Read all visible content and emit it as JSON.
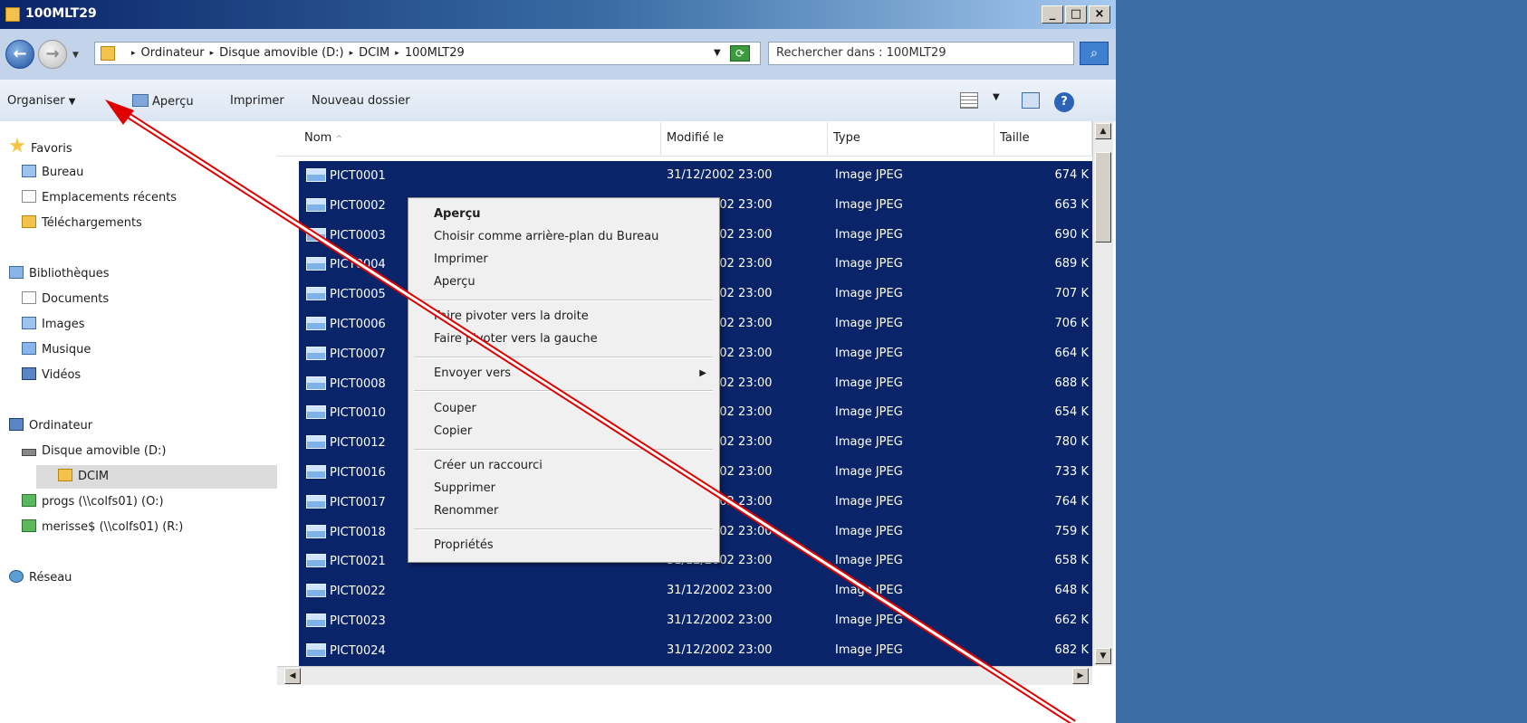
{
  "window": {
    "title": "100MLT29"
  },
  "address": {
    "crumbs": [
      "Ordinateur",
      "Disque amovible (D:)",
      "DCIM",
      "100MLT29"
    ],
    "search_placeholder": "Rechercher dans : 100MLT29"
  },
  "toolbar": {
    "organize_label": "Organiser",
    "preview_label": "Aperçu",
    "print_label": "Imprimer",
    "new_folder_label": "Nouveau dossier"
  },
  "nav": {
    "favorites": "Favoris",
    "desktop": "Bureau",
    "recent": "Emplacements récents",
    "downloads": "Téléchargements",
    "libraries": "Bibliothèques",
    "documents": "Documents",
    "images": "Images",
    "music": "Musique",
    "videos": "Vidéos",
    "computer": "Ordinateur",
    "removable": "Disque amovible (D:)",
    "dcim": "DCIM",
    "progs": "progs (\\\\colfs01) (O:)",
    "merisse": "merisse$ (\\\\colfs01) (R:)",
    "network": "Réseau"
  },
  "columns": {
    "name": "Nom",
    "modified": "Modifié le",
    "type": "Type",
    "size": "Taille"
  },
  "files": [
    {
      "name": "PICT0001",
      "modified": "31/12/2002 23:00",
      "type": "Image JPEG",
      "size": "674 K"
    },
    {
      "name": "PICT0002",
      "modified": "31/12/2002 23:00",
      "type": "Image JPEG",
      "size": "663 K"
    },
    {
      "name": "PICT0003",
      "modified": "31/12/2002 23:00",
      "type": "Image JPEG",
      "size": "690 K"
    },
    {
      "name": "PICT0004",
      "modified": "31/12/2002 23:00",
      "type": "Image JPEG",
      "size": "689 K"
    },
    {
      "name": "PICT0005",
      "modified": "31/12/2002 23:00",
      "type": "Image JPEG",
      "size": "707 K"
    },
    {
      "name": "PICT0006",
      "modified": "31/12/2002 23:00",
      "type": "Image JPEG",
      "size": "706 K"
    },
    {
      "name": "PICT0007",
      "modified": "31/12/2002 23:00",
      "type": "Image JPEG",
      "size": "664 K"
    },
    {
      "name": "PICT0008",
      "modified": "31/12/2002 23:00",
      "type": "Image JPEG",
      "size": "688 K"
    },
    {
      "name": "PICT0010",
      "modified": "31/12/2002 23:00",
      "type": "Image JPEG",
      "size": "654 K"
    },
    {
      "name": "PICT0012",
      "modified": "31/12/2002 23:00",
      "type": "Image JPEG",
      "size": "780 K"
    },
    {
      "name": "PICT0016",
      "modified": "31/12/2002 23:00",
      "type": "Image JPEG",
      "size": "733 K"
    },
    {
      "name": "PICT0017",
      "modified": "31/12/2002 23:00",
      "type": "Image JPEG",
      "size": "764 K"
    },
    {
      "name": "PICT0018",
      "modified": "31/12/2002 23:00",
      "type": "Image JPEG",
      "size": "759 K"
    },
    {
      "name": "PICT0021",
      "modified": "31/12/2002 23:00",
      "type": "Image JPEG",
      "size": "658 K"
    },
    {
      "name": "PICT0022",
      "modified": "31/12/2002 23:00",
      "type": "Image JPEG",
      "size": "648 K"
    },
    {
      "name": "PICT0023",
      "modified": "31/12/2002 23:00",
      "type": "Image JPEG",
      "size": "662 K"
    },
    {
      "name": "PICT0024",
      "modified": "31/12/2002 23:00",
      "type": "Image JPEG",
      "size": "682 K"
    }
  ],
  "context_menu": {
    "preview_bold": "Aperçu",
    "set_background": "Choisir comme arrière-plan du Bureau",
    "print": "Imprimer",
    "preview": "Aperçu",
    "rotate_right": "Faire pivoter vers la droite",
    "rotate_left": "Faire pivoter vers la gauche",
    "send_to": "Envoyer vers",
    "cut": "Couper",
    "copy": "Copier",
    "create_shortcut": "Créer un raccourci",
    "delete": "Supprimer",
    "rename": "Renommer",
    "properties": "Propriétés"
  },
  "colors": {
    "selection": "#0a246a",
    "desktop": "#3a6ea5",
    "annotation_arrow": "#e00000"
  }
}
